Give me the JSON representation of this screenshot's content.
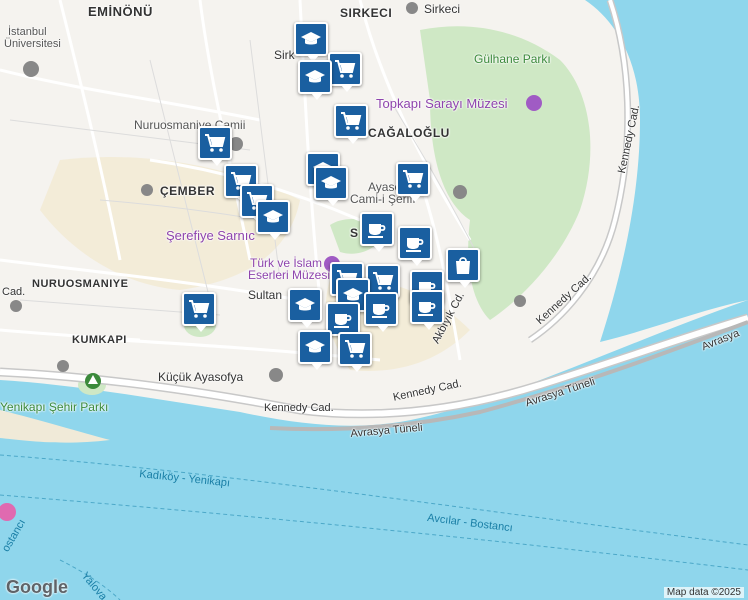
{
  "labels": {
    "eminonu": "EMİNÖNÜ",
    "sirkeci_top": "SIRKECI",
    "sirkeci_station": "Sirkeci",
    "sirkeci_small": "Sirk",
    "universite1": "İstanbul",
    "universite2": "Üniversitesi",
    "gulhane": "Gülhane Parkı",
    "topkapi": "Topkapı Sarayı Müzesi",
    "nuruosmaniye_camii": "Nuruosmaniye Camii",
    "cagaloglu": "CAĞALOĞLU",
    "cemberlitas": "ÇEMBER",
    "ayasofya1": "Ayasofya-",
    "ayasofya2": "Cami-i Şerifi",
    "serefiye": "Şerefiye Sarnıc",
    "sultanahmet": "S   MET",
    "turk_islam1": "Türk ve İslam",
    "turk_islam2": "Eserleri Müzesi",
    "sultan": "Sultan",
    "nuruosmaniye": "NURUOSMANIYE",
    "cad": "Cad.",
    "kumkapi": "KUMKAPI",
    "kucuk_ayasofya": "Küçük Ayasofya",
    "yenikapi_park": "Yenikapı Şehir Parkı",
    "kennedy1": "Kennedy Cad.",
    "kennedy2": "Kennedy Cad.",
    "kennedy_vertical": "Kennedy Cad.",
    "kennedy_right": "Kennedy Cad.",
    "kennedy_diag": "Kennedy Cad.",
    "avrasya1": "Avrasya Tüneli",
    "avrasya2": "Avrasya Tüneli",
    "avrasya3": "Avrasya",
    "akbiyik": "Akbıyık Cd.",
    "kadikoy": "Kadıköy - Yenikapı",
    "avcilar": "Avcılar - Bostancı",
    "yalova": "Yalova",
    "bostanci_left": "ostancı"
  },
  "attribution": "Map data ©2025",
  "logo": "Google",
  "colors": {
    "water": "#aadaff",
    "sea": "#8fd6ec",
    "land": "#f5f3ef",
    "park": "#cfe8c5",
    "marker": "#1a5fa0"
  },
  "markers": [
    {
      "type": "school",
      "name": "school-marker"
    },
    {
      "type": "shopping",
      "name": "shopping-marker"
    },
    {
      "type": "school",
      "name": "school-marker"
    },
    {
      "type": "shopping",
      "name": "shopping-marker"
    },
    {
      "type": "shopping",
      "name": "shopping-marker"
    },
    {
      "type": "shopping",
      "name": "shopping-marker"
    },
    {
      "type": "school",
      "name": "school-marker"
    },
    {
      "type": "school",
      "name": "school-marker"
    },
    {
      "type": "shopping",
      "name": "shopping-marker"
    },
    {
      "type": "shopping",
      "name": "shopping-marker"
    },
    {
      "type": "school",
      "name": "school-marker"
    },
    {
      "type": "cafe",
      "name": "cafe-marker"
    },
    {
      "type": "cafe",
      "name": "cafe-marker"
    },
    {
      "type": "shopping-bag",
      "name": "shopping-bag-marker"
    },
    {
      "type": "shopping",
      "name": "shopping-marker"
    },
    {
      "type": "shopping",
      "name": "shopping-marker"
    },
    {
      "type": "cafe",
      "name": "cafe-marker"
    },
    {
      "type": "school",
      "name": "school-marker"
    },
    {
      "type": "school",
      "name": "school-marker"
    },
    {
      "type": "cafe",
      "name": "cafe-marker"
    },
    {
      "type": "cafe",
      "name": "cafe-marker"
    },
    {
      "type": "cafe",
      "name": "cafe-marker"
    },
    {
      "type": "school",
      "name": "school-marker"
    },
    {
      "type": "shopping",
      "name": "shopping-marker"
    },
    {
      "type": "shopping",
      "name": "shopping-marker"
    }
  ]
}
